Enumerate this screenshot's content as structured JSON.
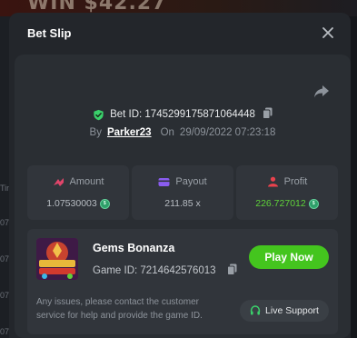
{
  "modal": {
    "title": "Bet Slip"
  },
  "bet": {
    "id_label": "Bet ID: 1745299175871064448",
    "by_label": "By",
    "user": "Parker23",
    "on_label": "On",
    "date": "29/09/2022 07:23:18"
  },
  "stats": [
    {
      "label": "Amount",
      "value": "1.07530003",
      "icon": "amount-icon",
      "color": "#e0456a"
    },
    {
      "label": "Payout",
      "value": "211.85 x",
      "icon": "payout-icon",
      "color": "#8a5cf0"
    },
    {
      "label": "Profit",
      "value": "226.727012",
      "icon": "profit-icon",
      "color": "#e8424d"
    }
  ],
  "game": {
    "name": "Gems Bonanza",
    "id_label": "Game ID: 7214642576013",
    "play_label": "Play Now",
    "help": "Any issues, please contact the customer service for help and provide the game ID.",
    "support_label": "Live Support"
  },
  "colors": {
    "accent_green": "#44c51e",
    "profit_green": "#5fd13a",
    "verified_green": "#3ad16b"
  }
}
